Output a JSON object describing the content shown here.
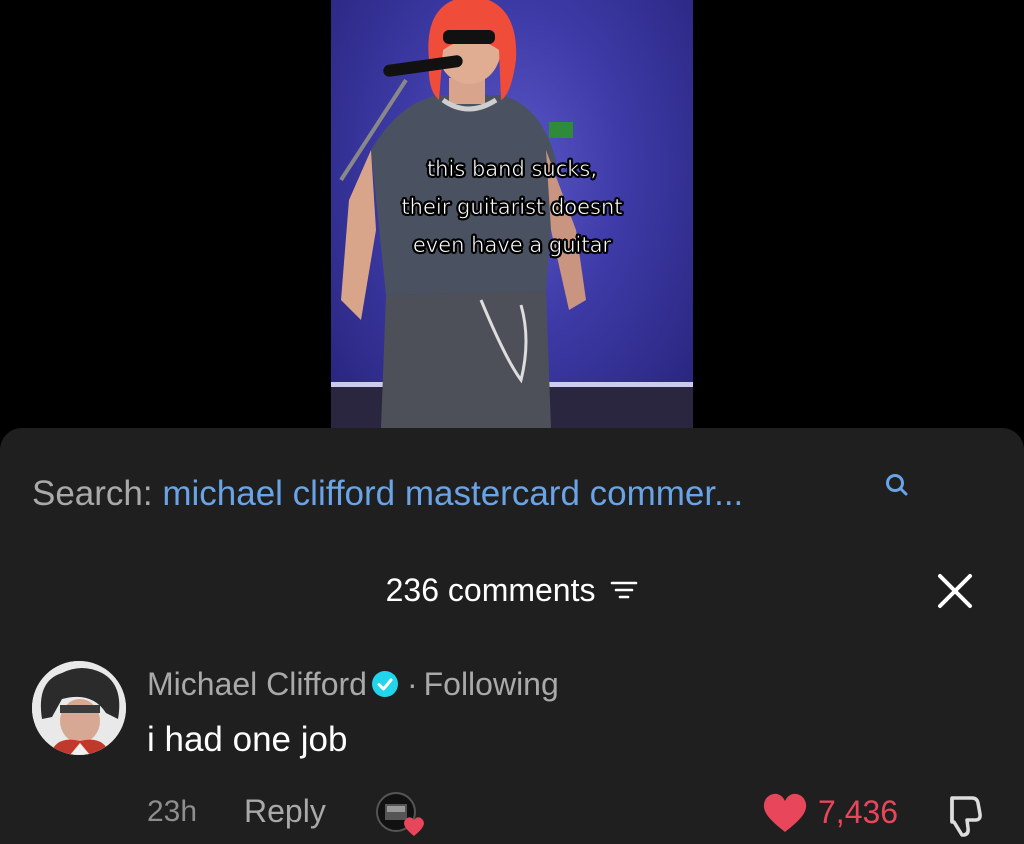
{
  "video": {
    "caption_lines": [
      "this band sucks,",
      "their guitarist doesnt",
      "even have a guitar"
    ]
  },
  "search": {
    "label": "Search:",
    "query": "michael clifford mastercard commer..."
  },
  "comments": {
    "count_label": "236 comments"
  },
  "comment": {
    "author": "Michael Clifford",
    "separator": "·",
    "relation": "Following",
    "text": "i had one job",
    "time": "23h",
    "reply_label": "Reply",
    "likes": "7,436"
  },
  "colors": {
    "sheet_bg": "#1f1f1f",
    "link_blue": "#6aa4e6",
    "like_red": "#e8465a",
    "verified_blue": "#20d5ec"
  },
  "icons": [
    "search-icon",
    "filter-icon",
    "close-icon",
    "verified-icon",
    "creator-liked-icon",
    "heart-icon",
    "dislike-icon"
  ]
}
